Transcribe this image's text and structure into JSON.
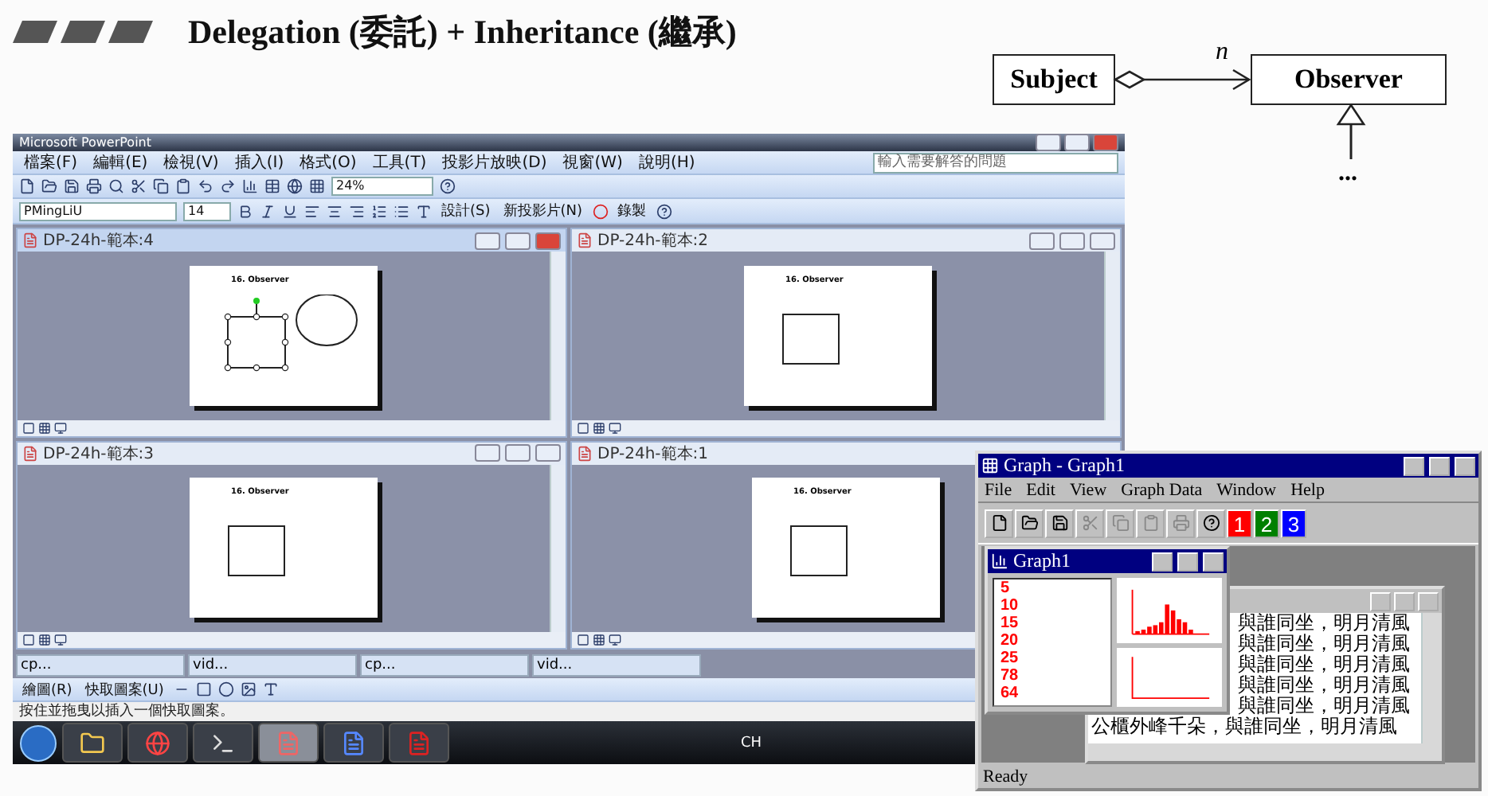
{
  "slide": {
    "title": "Delegation (委託) + Inheritance (繼承)"
  },
  "uml": {
    "subject": "Subject",
    "observer": "Observer",
    "multiplicity": "n",
    "more": "..."
  },
  "powerpoint": {
    "title": "Microsoft PowerPoint",
    "menus": [
      "檔案(F)",
      "編輯(E)",
      "檢視(V)",
      "插入(I)",
      "格式(O)",
      "工具(T)",
      "投影片放映(D)",
      "視窗(W)",
      "說明(H)"
    ],
    "help_placeholder": "輸入需要解答的問題",
    "zoom": "24%",
    "font": "PMingLiU",
    "font_size": "14",
    "text_buttons": [
      "設計(S)",
      "新投影片(N)"
    ],
    "record_button": "錄製",
    "windows": [
      {
        "title": "DP-24h-範本:4",
        "active": true,
        "slide_title": "16. Observer",
        "kind": "selection"
      },
      {
        "title": "DP-24h-範本:2",
        "active": false,
        "slide_title": "16. Observer",
        "kind": "square"
      },
      {
        "title": "DP-24h-範本:3",
        "active": false,
        "slide_title": "16. Observer",
        "kind": "square"
      },
      {
        "title": "DP-24h-範本:1",
        "active": false,
        "slide_title": "16. Observer",
        "kind": "square"
      }
    ],
    "minimized": [
      "cp...",
      "vid...",
      "cp...",
      "vid..."
    ],
    "drawing_menus": [
      "繪圖(R)",
      "快取圖案(U)"
    ],
    "status": "按住並拖曳以插入一個快取圖案。",
    "language": "CH"
  },
  "graph": {
    "title": "Graph - Graph1",
    "menus": [
      "File",
      "Edit",
      "View",
      "Graph Data",
      "Window",
      "Help"
    ],
    "color_buttons": [
      {
        "label": "1",
        "color": "#ff0000"
      },
      {
        "label": "2",
        "color": "#008000"
      },
      {
        "label": "3",
        "color": "#0000ff"
      }
    ],
    "child": {
      "title": "Graph1",
      "values": [
        "5",
        "10",
        "15",
        "20",
        "25",
        "78",
        "64"
      ]
    },
    "text_lines": [
      "與誰同坐，明月清風",
      "與誰同坐，明月清風",
      "與誰同坐，明月清風",
      "與誰同坐，明月清風",
      "與誰同坐，明月清風"
    ],
    "last_line": "公櫃外峰千朵，與誰同坐，明月清風",
    "status": "Ready"
  }
}
